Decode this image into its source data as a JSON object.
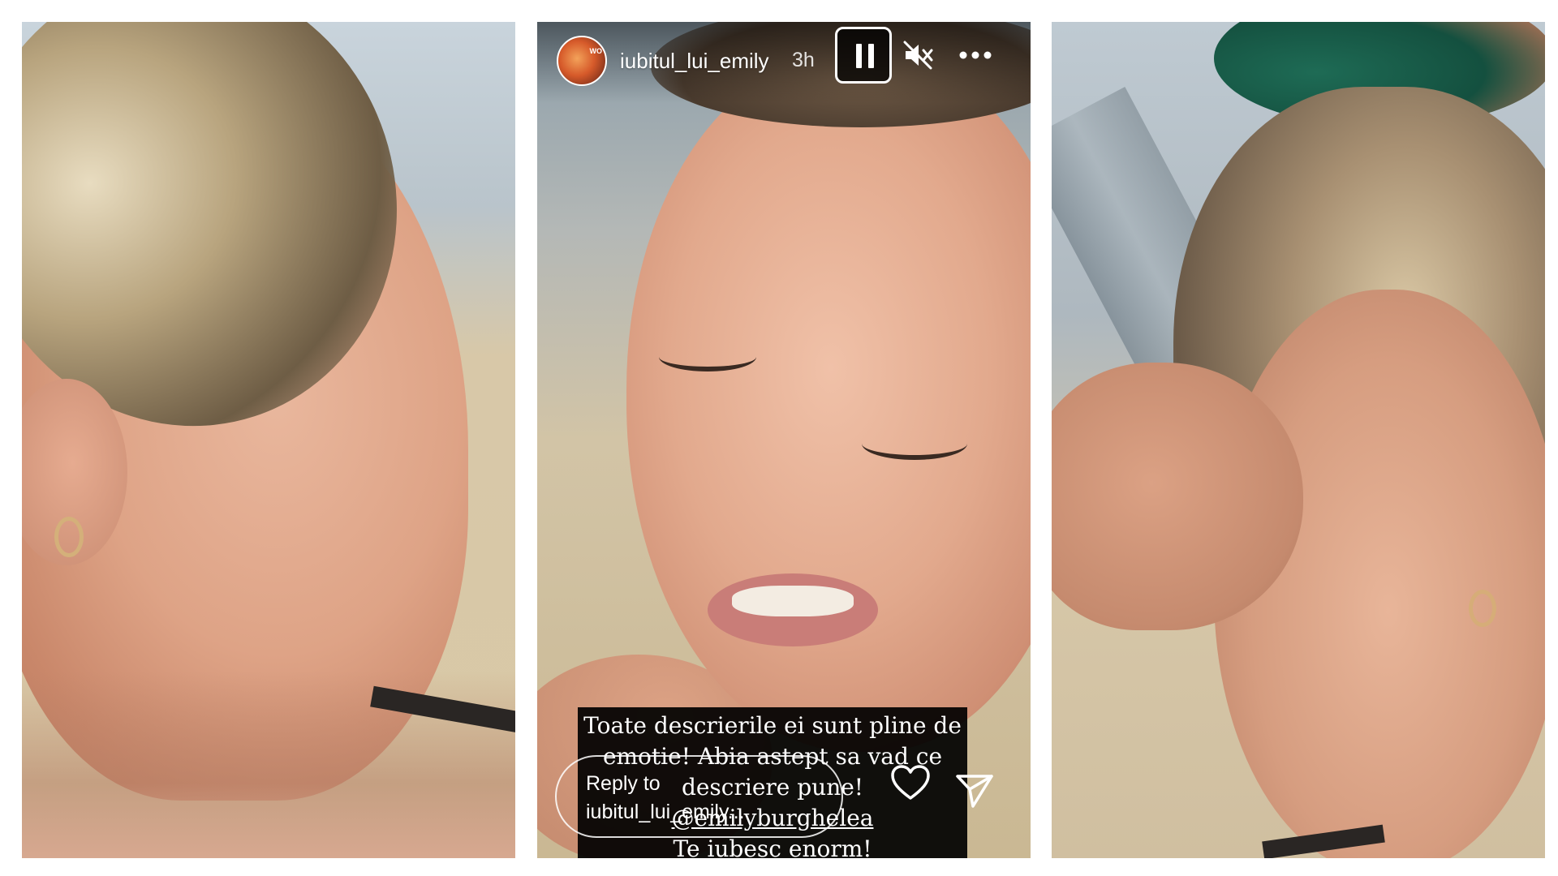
{
  "panels": {
    "left": {
      "description_name": "story-frame-left"
    },
    "center": {
      "story": {
        "username": "iubitul_lui_emily",
        "timestamp": "3h",
        "avatar_badge": "WO",
        "controls": {
          "pause_icon": "pause-icon",
          "mute_icon": "speaker-muted-icon",
          "more_icon": "more-horizontal-icon"
        },
        "caption_lines": [
          "Toate descrierile ei sunt pline de",
          "emotie! Abia astept sa vad ce",
          "descriere pune!",
          "@emilyburghelea",
          "Te iubesc enorm!"
        ],
        "reply": {
          "line1": "Reply to",
          "line2": "iubitul_lui_emily..."
        },
        "actions": {
          "like_icon": "heart-icon",
          "share_icon": "send-icon"
        }
      }
    },
    "right": {
      "description_name": "story-frame-right"
    }
  },
  "colors": {
    "page_background": "#ffffff",
    "overlay_text": "#ffffff",
    "caption_background": "#000000"
  }
}
